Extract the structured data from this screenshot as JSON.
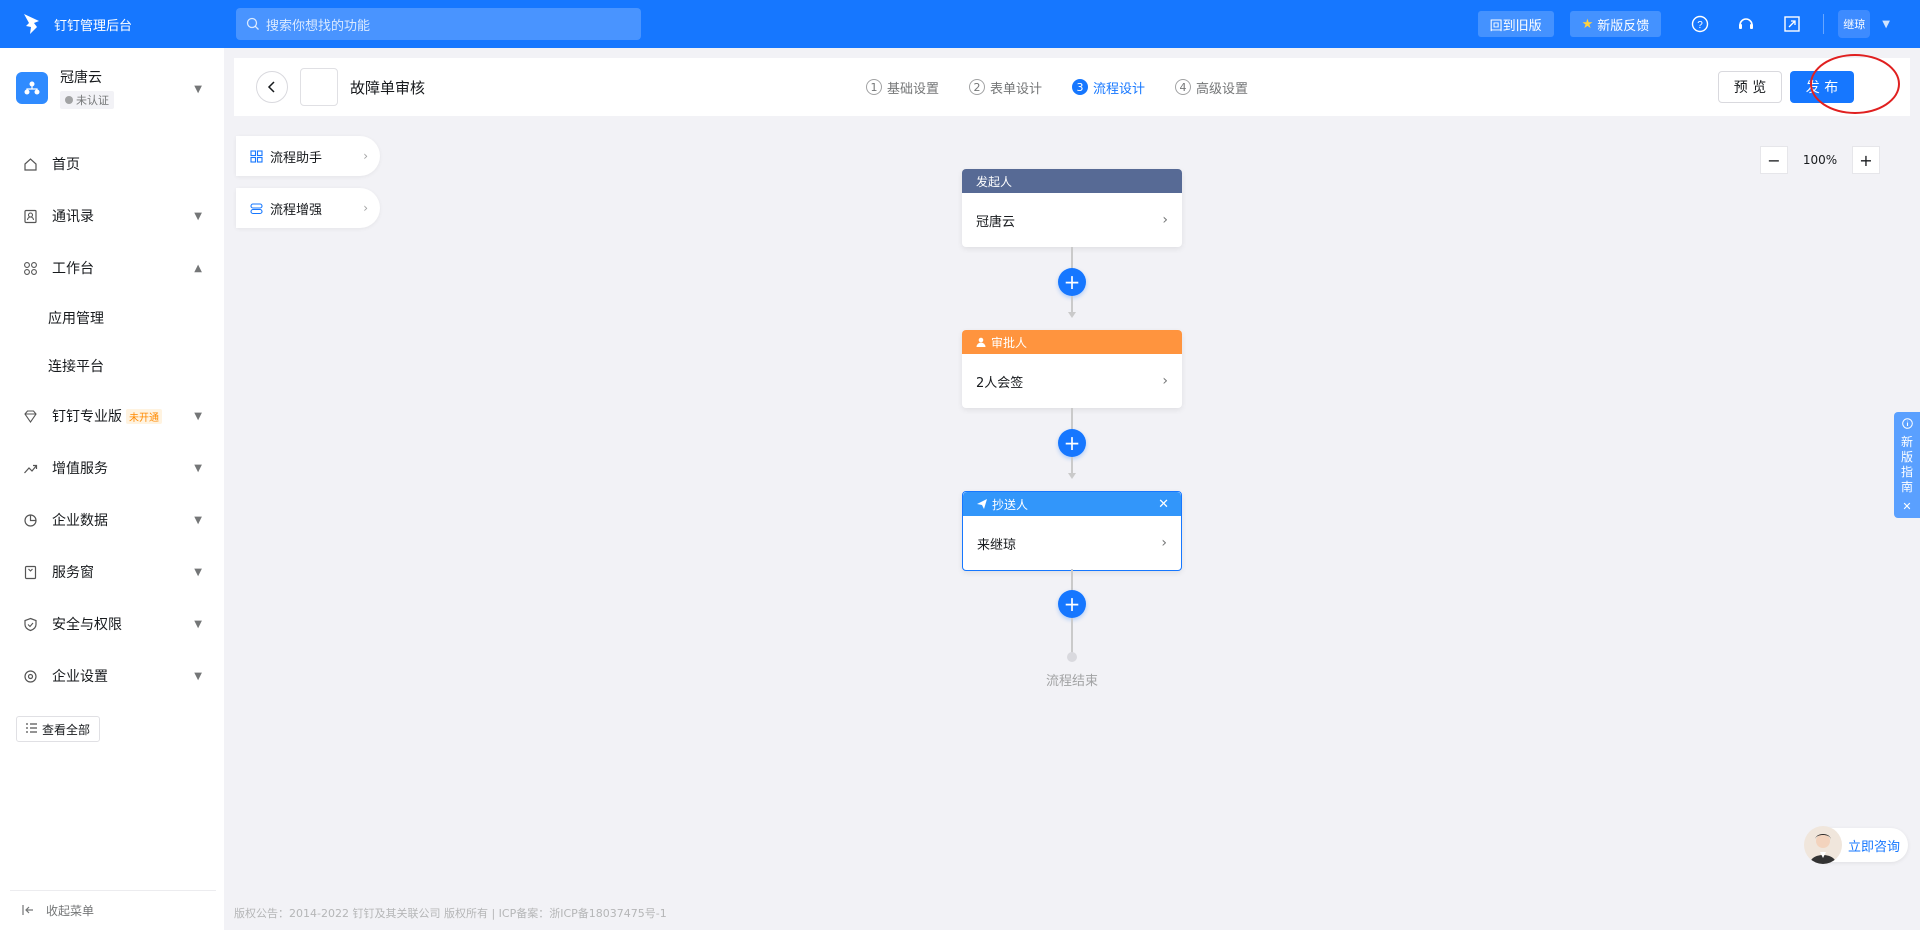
{
  "app": {
    "title": "钉钉管理后台"
  },
  "search": {
    "placeholder": "搜索你想找的功能"
  },
  "topbar": {
    "old_version_label": "回到旧版",
    "feedback_label": "新版反馈",
    "user_name": "继琼"
  },
  "org": {
    "name": "冠唐云",
    "badge": "未认证"
  },
  "sidebar": {
    "items": [
      {
        "label": "首页"
      },
      {
        "label": "通讯录"
      },
      {
        "label": "工作台"
      },
      {
        "label": "钉钉专业版",
        "tag": "未开通"
      },
      {
        "label": "增值服务"
      },
      {
        "label": "企业数据"
      },
      {
        "label": "服务窗"
      },
      {
        "label": "安全与权限"
      },
      {
        "label": "企业设置"
      }
    ],
    "sub_items": [
      {
        "label": "应用管理"
      },
      {
        "label": "连接平台"
      }
    ],
    "view_all_label": "查看全部",
    "collapse_label": "收起菜单"
  },
  "header": {
    "form_title": "故障单审核",
    "steps": [
      {
        "num": "1",
        "label": "基础设置"
      },
      {
        "num": "2",
        "label": "表单设计"
      },
      {
        "num": "3",
        "label": "流程设计"
      },
      {
        "num": "4",
        "label": "高级设置"
      }
    ],
    "active_step": 3,
    "preview_label": "预 览",
    "publish_label": "发 布"
  },
  "helpers": [
    {
      "label": "流程助手"
    },
    {
      "label": "流程增强"
    }
  ],
  "zoom": {
    "value": "100%"
  },
  "flow": {
    "nodes": [
      {
        "type": "initiator",
        "title": "发起人",
        "content": "冠唐云",
        "color": "#576a95"
      },
      {
        "type": "approver",
        "title": "审批人",
        "content": "2人会签",
        "color": "#ff943e"
      },
      {
        "type": "cc",
        "title": "抄送人",
        "content": "来继琼",
        "color": "#3296fa"
      }
    ],
    "end_label": "流程结束"
  },
  "guide": {
    "chars": [
      "新",
      "版",
      "指",
      "南"
    ]
  },
  "consult": {
    "label": "立即咨询"
  },
  "footer": {
    "text": "版权公告：2014-2022 钉钉及其关联公司 版权所有 | ICP备案：浙ICP备18037475号-1"
  },
  "colors": {
    "primary": "#1677ff",
    "initiator": "#576a95",
    "approver": "#ff943e",
    "cc": "#3296fa"
  }
}
